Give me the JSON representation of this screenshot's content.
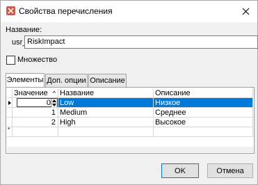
{
  "window": {
    "title": "Свойства перечисления"
  },
  "form": {
    "name_label": "Название:",
    "name_prefix": "usr_",
    "name_value": "RiskImpact",
    "multiple_label": "Множество",
    "multiple_checked": false
  },
  "tabs": [
    {
      "label": "Элементы",
      "active": true
    },
    {
      "label": "Доп. опции",
      "active": false
    },
    {
      "label": "Описание",
      "active": false
    }
  ],
  "grid": {
    "columns": [
      "Значение",
      "Название",
      "Описание"
    ],
    "rows": [
      {
        "value": "0",
        "name": "Low",
        "description": "Низкое",
        "selected": true
      },
      {
        "value": "1",
        "name": "Medium",
        "description": "Среднее",
        "selected": false
      },
      {
        "value": "2",
        "name": "High",
        "description": "Высокое",
        "selected": false
      }
    ]
  },
  "buttons": {
    "ok": "OK",
    "cancel": "Отмена"
  },
  "colors": {
    "selection": "#0078d7",
    "app_icon": "#e5533d"
  }
}
